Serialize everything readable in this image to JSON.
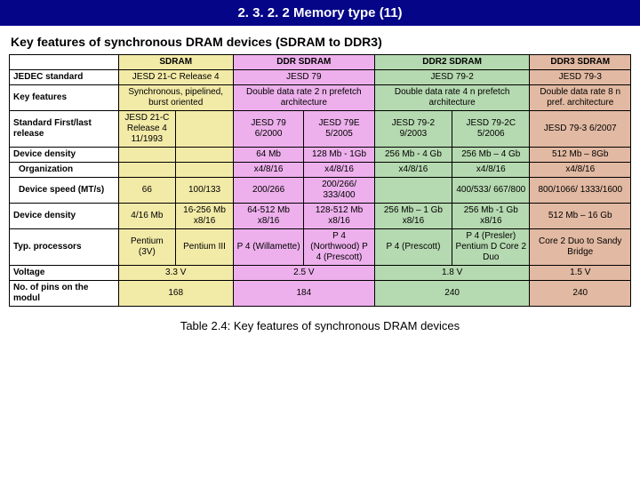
{
  "title": "2. 3. 2. 2 Memory type (11)",
  "subtitle": "Key features of synchronous DRAM devices (SDRAM to DDR3)",
  "caption": "Table 2.4: Key features of synchronous DRAM devices",
  "headers": {
    "sdram": "SDRAM",
    "ddr": "DDR SDRAM",
    "ddr2": "DDR2 SDRAM",
    "ddr3": "DDR3 SDRAM"
  },
  "rows": {
    "jedec": {
      "label": "JEDEC standard",
      "sdram": "JESD 21-C Release 4",
      "ddr": "JESD 79",
      "ddr2": "JESD 79-2",
      "ddr3": "JESD 79-3"
    },
    "keyfeat": {
      "label": "Key features",
      "sdram": "Synchronous, pipelined, burst oriented",
      "ddr": "Double data rate 2 n prefetch architecture",
      "ddr2": "Double data rate 4 n prefetch architecture",
      "ddr3": "Double data rate 8 n pref. architecture"
    },
    "std": {
      "label": "Standard First/last release",
      "sdram_a": "JESD 21-C Release 4 11/1993",
      "sdram_b": "",
      "ddr_a": "JESD 79 6/2000",
      "ddr_b": "JESD 79E 5/2005",
      "ddr2_a": "JESD 79-2 9/2003",
      "ddr2_b": "JESD 79-2C 5/2006",
      "ddr3": "JESD 79-3 6/2007"
    },
    "dens1": {
      "label": "Device density",
      "sdram_a": "",
      "sdram_b": "",
      "ddr_a": "64 Mb",
      "ddr_b": "128 Mb - 1Gb",
      "ddr2_a": "256 Mb - 4 Gb",
      "ddr2_b": "256 Mb – 4 Gb",
      "ddr3": "512 Mb – 8Gb"
    },
    "org": {
      "label": "Organization",
      "sdram_a": "",
      "sdram_b": "",
      "ddr_a": "x4/8/16",
      "ddr_b": "x4/8/16",
      "ddr2_a": "x4/8/16",
      "ddr2_b": "x4/8/16",
      "ddr3": "x4/8/16"
    },
    "speed": {
      "label": "Device speed (MT/s)",
      "sdram_a": "66",
      "sdram_b": "100/133",
      "ddr_a": "200/266",
      "ddr_b": "200/266/ 333/400",
      "ddr2_a": "",
      "ddr2_b": "400/533/ 667/800",
      "ddr3": "800/1066/ 1333/1600"
    },
    "dens2": {
      "label": "Device density",
      "sdram_a": "4/16 Mb",
      "sdram_b": "16-256 Mb x8/16",
      "ddr_a": "64-512 Mb x8/16",
      "ddr_b": "128-512 Mb x8/16",
      "ddr2_a": "256 Mb – 1 Gb x8/16",
      "ddr2_b": "256 Mb -1 Gb x8/16",
      "ddr3": "512 Mb – 16 Gb"
    },
    "proc": {
      "label": "Typ. processors",
      "sdram_a": "Pentium (3V)",
      "sdram_b": "Pentium III",
      "ddr_a": "P 4 (Willamette)",
      "ddr_b": "P 4 (Northwood) P 4 (Prescott)",
      "ddr2_a": "P 4 (Prescott)",
      "ddr2_b": "P 4 (Presler) Pentium D Core 2 Duo",
      "ddr3": "Core 2 Duo to Sandy Bridge"
    },
    "volt": {
      "label": "Voltage",
      "sdram": "3.3 V",
      "ddr": "2.5 V",
      "ddr2": "1.8 V",
      "ddr3": "1.5 V"
    },
    "pins": {
      "label": "No. of pins on the modul",
      "sdram": "168",
      "ddr": "184",
      "ddr2": "240",
      "ddr3": "240"
    }
  }
}
